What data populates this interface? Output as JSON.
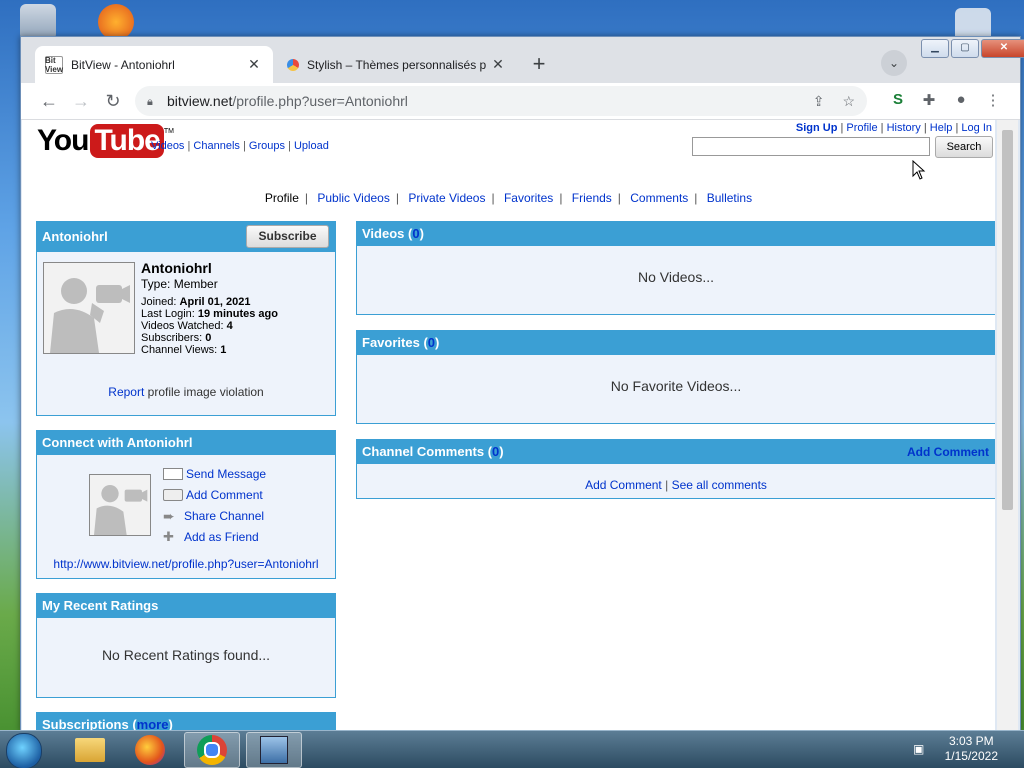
{
  "browser": {
    "tabs": [
      {
        "title": "BitView - Antoniohrl",
        "favicon": "bitview-icon",
        "favicon_text": "Bit View",
        "active": true
      },
      {
        "title": "Stylish – Thèmes personnalisés p",
        "favicon": "stylish-icon",
        "active": false
      }
    ],
    "url_host": "bitview.net",
    "url_path": "/profile.php?user=Antoniohrl"
  },
  "site": {
    "logo_you": "You",
    "logo_tube": "Tube",
    "logo_tm": "TM",
    "main_nav": [
      "Videos",
      "Channels",
      "Groups",
      "Upload"
    ],
    "top_links": [
      "Sign Up",
      "Profile",
      "History",
      "Help",
      "Log In"
    ],
    "search_label": "Search",
    "search_value": ""
  },
  "profile_nav": {
    "current": "Profile",
    "links": [
      "Public Videos",
      "Private Videos",
      "Favorites",
      "Friends",
      "Comments",
      "Bulletins"
    ]
  },
  "profile_box": {
    "header": "Antoniohrl",
    "subscribe_label": "Subscribe",
    "name": "Antoniohrl",
    "type_label": "Type:",
    "type_value": "Member",
    "joined_label": "Joined:",
    "joined_value": "April 01, 2021",
    "last_login_label": "Last Login:",
    "last_login_value": "19 minutes ago",
    "videos_watched_label": "Videos Watched:",
    "videos_watched_value": "4",
    "subscribers_label": "Subscribers:",
    "subscribers_value": "0",
    "channel_views_label": "Channel Views:",
    "channel_views_value": "1",
    "report_link": "Report",
    "report_text": "profile image violation"
  },
  "connect_box": {
    "header": "Connect with Antoniohrl",
    "actions": [
      {
        "label": "Send Message",
        "icon": "envelope-icon"
      },
      {
        "label": "Add Comment",
        "icon": "comment-icon"
      },
      {
        "label": "Share Channel",
        "icon": "share-arrow-icon"
      },
      {
        "label": "Add as Friend",
        "icon": "add-friend-icon"
      }
    ],
    "profile_url": "http://www.bitview.net/profile.php?user=Antoniohrl"
  },
  "ratings_box": {
    "header": "My Recent Ratings",
    "empty": "No Recent Ratings found..."
  },
  "subscriptions_box": {
    "header": "Subscriptions",
    "open_paren": "(",
    "more": "more",
    "close_paren": ")"
  },
  "videos_box": {
    "header": "Videos",
    "open_paren": "(",
    "count": "0",
    "close_paren": ")",
    "empty": "No Videos..."
  },
  "favorites_box": {
    "header": "Favorites",
    "open_paren": "(",
    "count": "0",
    "close_paren": ")",
    "empty": "No Favorite Videos..."
  },
  "comments_box": {
    "header": "Channel Comments",
    "open_paren": "(",
    "count": "0",
    "close_paren": ")",
    "add_comment_header": "Add Comment",
    "add_comment": "Add Comment",
    "see_all": "See all comments"
  },
  "taskbar": {
    "items": [
      "windows-explorer-icon",
      "firefox-icon",
      "chrome-icon",
      "network-app-icon"
    ],
    "time": "3:03 PM",
    "date": "1/15/2022"
  },
  "colors": {
    "box_header": "#3b9fd4",
    "box_bg": "#eef3fb",
    "link": "#0033cc",
    "logo_red": "#cc1a1a"
  }
}
